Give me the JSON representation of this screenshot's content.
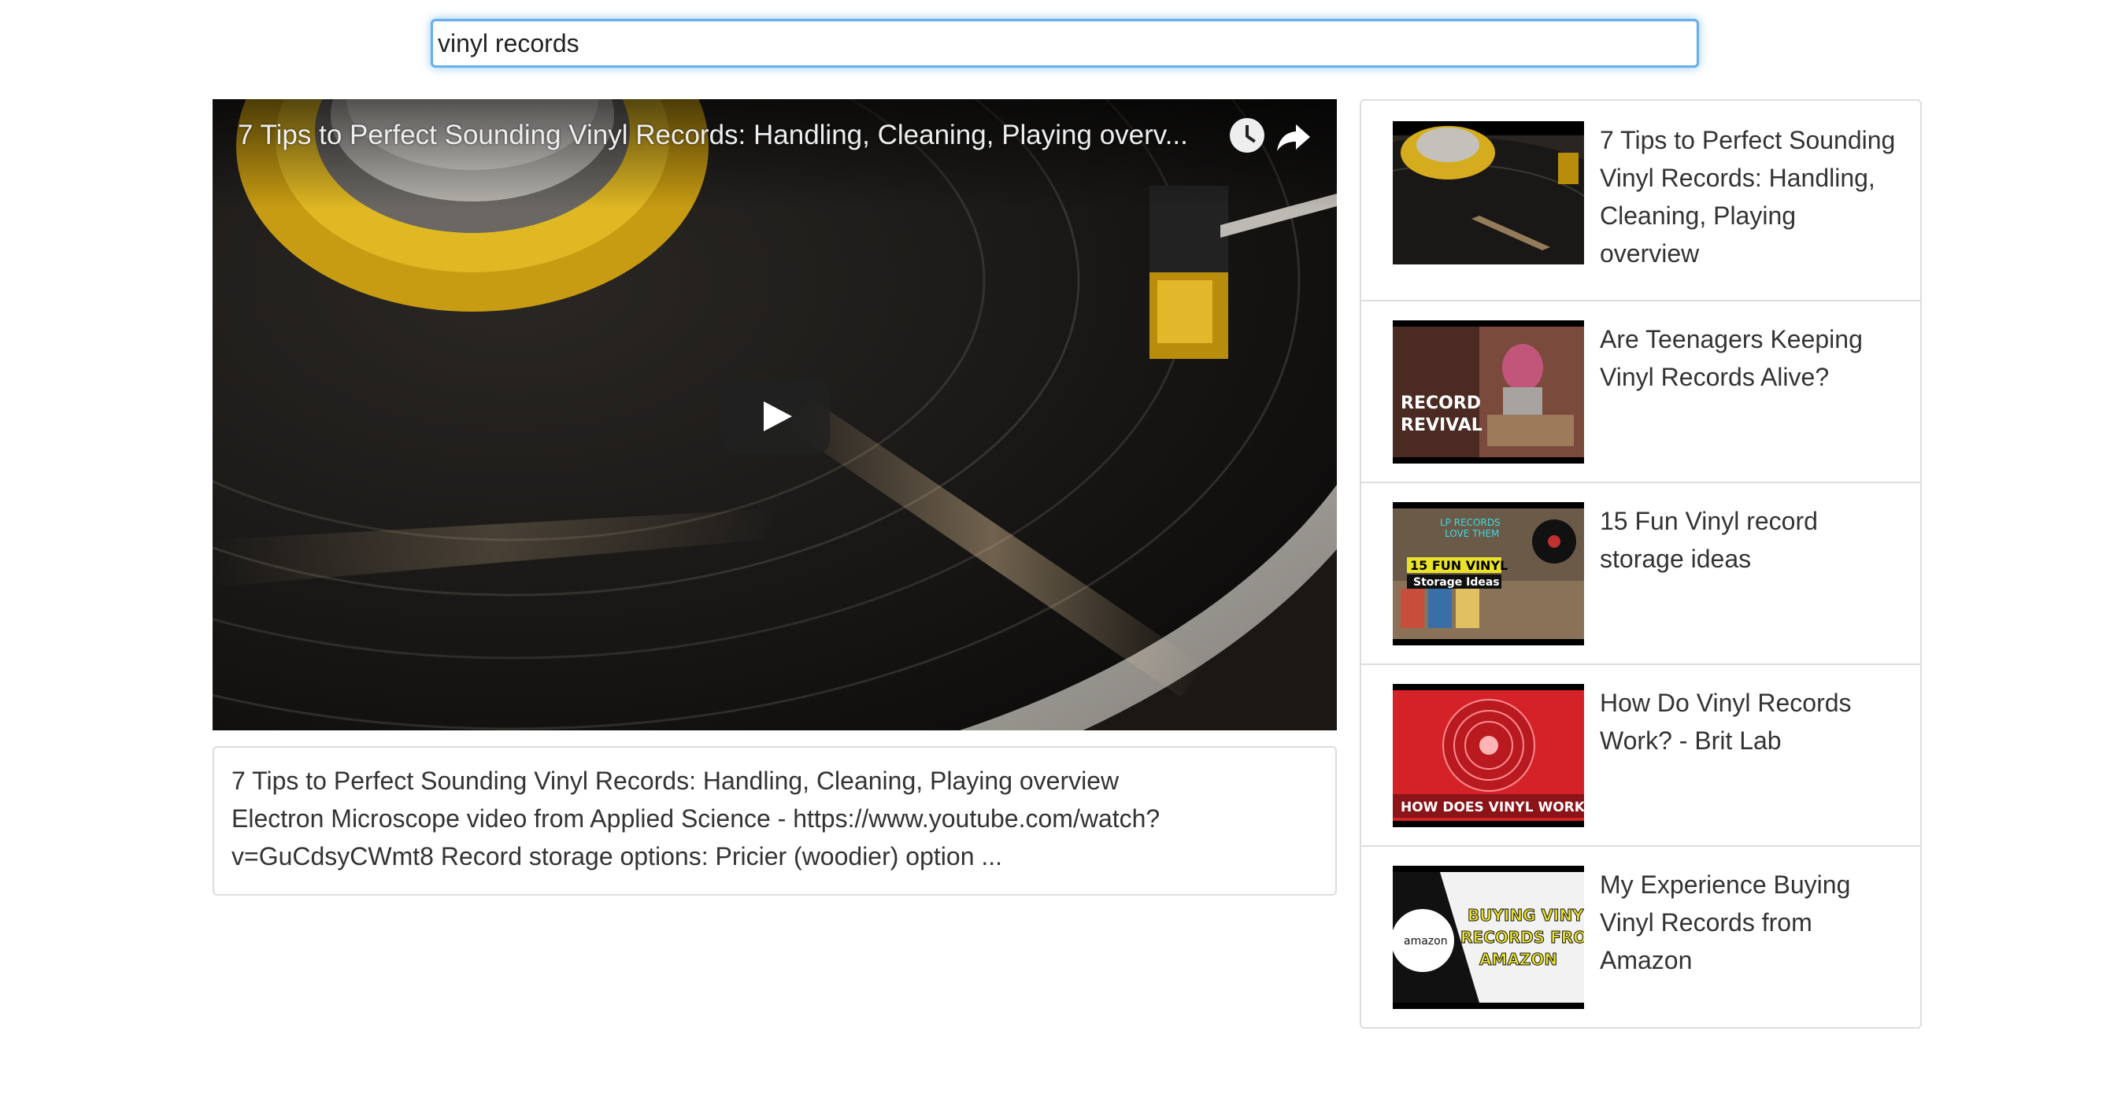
{
  "search": {
    "value": "vinyl records"
  },
  "player": {
    "title": "7 Tips to Perfect Sounding Vinyl Records: Handling, Cleaning, Playing overview",
    "title_display": "7 Tips to Perfect Sounding Vinyl Records: Handling, Cleaning, Playing overv...",
    "icons": [
      "watch-later-icon",
      "share-icon",
      "play-icon"
    ]
  },
  "description": {
    "title": "7 Tips to Perfect Sounding Vinyl Records: Handling, Cleaning, Playing overview",
    "text": "Electron Microscope video from Applied Science - https://www.youtube.com/watch?v=GuCdsyCWmt8 Record storage options: Pricier (woodier) option ..."
  },
  "results": [
    {
      "title": "7 Tips to Perfect Sounding Vinyl Records: Handling, Cleaning, Playing overview",
      "thumb_text": []
    },
    {
      "title": "Are Teenagers Keeping Vinyl Records Alive?",
      "thumb_text": [
        "RECORD",
        "REVIVAL"
      ]
    },
    {
      "title": "15 Fun Vinyl record storage ideas",
      "thumb_text": [
        "LP RECORDS",
        "LOVE THEM",
        "15 FUN VINYL",
        "Storage Ideas"
      ]
    },
    {
      "title": "How Do Vinyl Records Work? - Brit Lab",
      "thumb_text": [
        "HOW DOES VINYL WORK?"
      ]
    },
    {
      "title": "My Experience Buying Vinyl Records from Amazon",
      "thumb_text": [
        "amazon",
        "BUYING VINYL",
        "RECORDS FROM",
        "AMAZON"
      ]
    }
  ],
  "colors": {
    "focus_border": "#66afe9",
    "panel_border": "#dddddd",
    "text": "#333333"
  }
}
